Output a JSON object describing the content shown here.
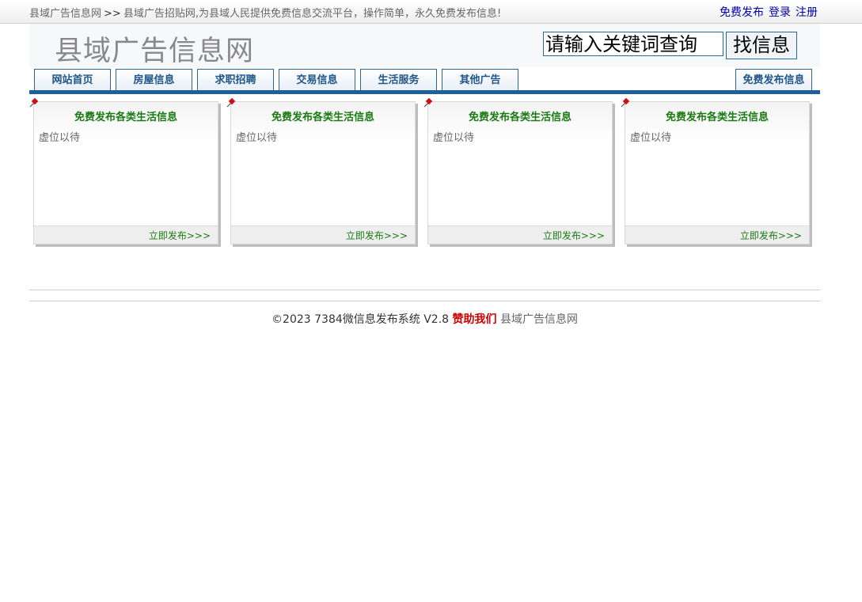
{
  "topbar": {
    "site_link": "县域广告信息网",
    "separator": ">>",
    "tagline": "县域广告招贴网,为县域人民提供免费信息交流平台，操作简单，永久免费发布信息!",
    "links": {
      "post": "免费发布",
      "login": "登录",
      "register": "注册"
    }
  },
  "header": {
    "logo": "县域广告信息网",
    "search": {
      "value": "请输入关键词查询",
      "button": "找信息"
    }
  },
  "nav": {
    "tabs": [
      {
        "label": "网站首页"
      },
      {
        "label": "房屋信息"
      },
      {
        "label": "求职招聘"
      },
      {
        "label": "交易信息"
      },
      {
        "label": "生活服务"
      },
      {
        "label": "其他广告"
      }
    ],
    "post_button": "免费发布信息"
  },
  "cards": [
    {
      "title": "免费发布各类生活信息",
      "body": "虚位以待",
      "link": "立即发布>>>"
    },
    {
      "title": "免费发布各类生活信息",
      "body": "虚位以待",
      "link": "立即发布>>>"
    },
    {
      "title": "免费发布各类生活信息",
      "body": "虚位以待",
      "link": "立即发布>>>"
    },
    {
      "title": "免费发布各类生活信息",
      "body": "虚位以待",
      "link": "立即发布>>>"
    }
  ],
  "footer": {
    "copyright": "©2023 7384微信息发布系统 V2.8",
    "sponsor": "赞助我们",
    "site_name": "县域广告信息网"
  },
  "colors": {
    "nav_blue": "#1d5f96",
    "card_green": "#1a7a12",
    "sponsor_red": "#cc0000",
    "link_blue": "#0000aa"
  },
  "icons": {
    "card_pin": "pushpin-icon"
  }
}
